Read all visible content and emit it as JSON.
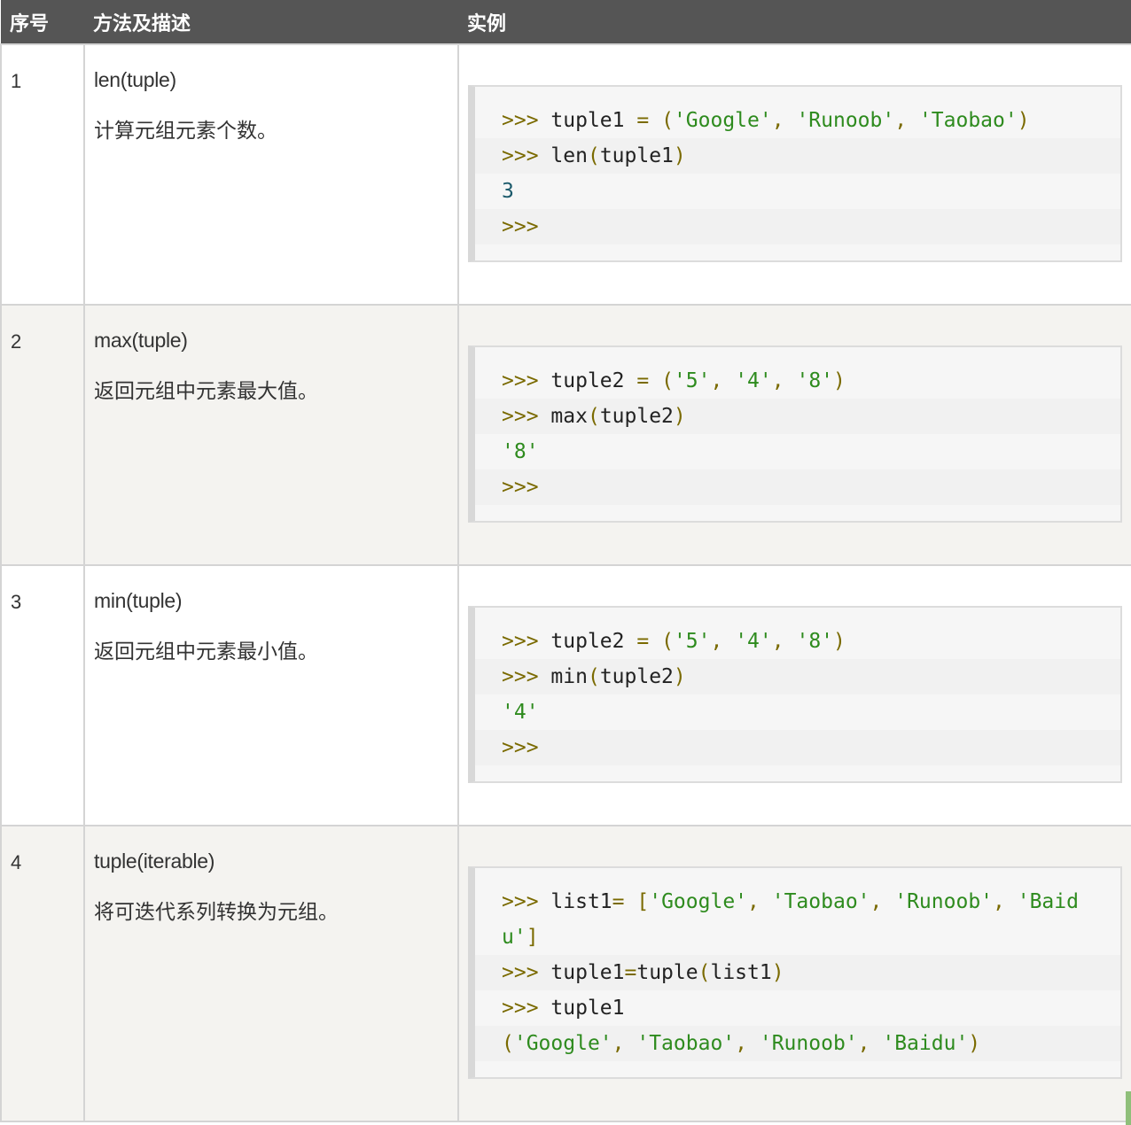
{
  "header": {
    "col_index": "序号",
    "col_method": "方法及描述",
    "col_example": "实例"
  },
  "rows": [
    {
      "index": "1",
      "method": "len(tuple)",
      "description": "计算元组元素个数。",
      "code": [
        ">>> tuple1 = ('Google', 'Runoob', 'Taobao')",
        ">>> len(tuple1)",
        "3",
        ">>>"
      ]
    },
    {
      "index": "2",
      "method": "max(tuple)",
      "description": "返回元组中元素最大值。",
      "code": [
        ">>> tuple2 = ('5', '4', '8')",
        ">>> max(tuple2)",
        "'8'",
        ">>>"
      ]
    },
    {
      "index": "3",
      "method": "min(tuple)",
      "description": "返回元组中元素最小值。",
      "code": [
        ">>> tuple2 = ('5', '4', '8')",
        ">>> min(tuple2)",
        "'4'",
        ">>>"
      ]
    },
    {
      "index": "4",
      "method": "tuple(iterable)",
      "description": "将可迭代系列转换为元组。",
      "code": [
        ">>> list1= ['Google', 'Taobao', 'Runoob', 'Baidu']",
        ">>> tuple1=tuple(list1)",
        ">>> tuple1",
        "('Google', 'Taobao', 'Runoob', 'Baidu')"
      ]
    }
  ]
}
